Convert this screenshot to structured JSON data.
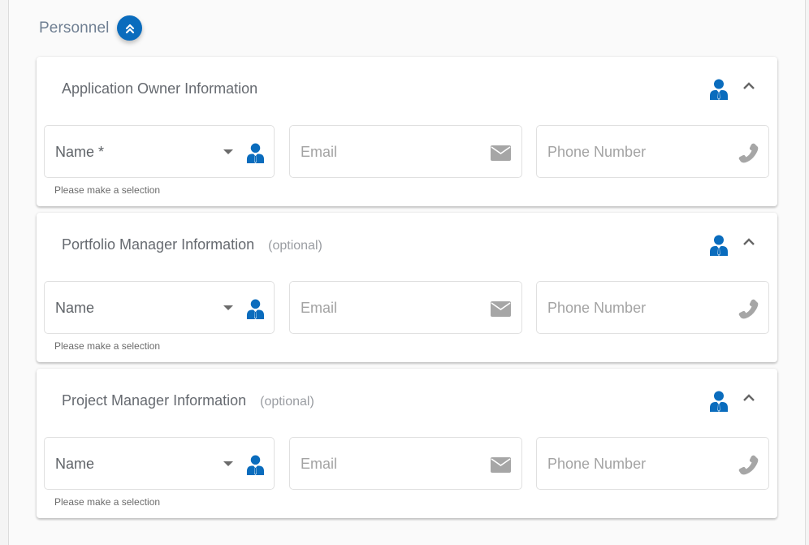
{
  "section": {
    "title": "Personnel",
    "collapse_icon": "double-chevron-up-icon"
  },
  "colors": {
    "accent": "#0a6cbd",
    "icon_gray": "#a6a6a6"
  },
  "cards": [
    {
      "title": "Application Owner Information",
      "optional": "",
      "header_icon": "person-tie-icon",
      "toggle_icon": "chevron-up-icon",
      "name_field": {
        "label": "Name *",
        "helper": "Please make a selection",
        "value": ""
      },
      "email_field": {
        "placeholder": "Email",
        "value": ""
      },
      "phone_field": {
        "placeholder": "Phone Number",
        "value": ""
      }
    },
    {
      "title": "Portfolio Manager Information",
      "optional": "(optional)",
      "header_icon": "person-tie-icon",
      "toggle_icon": "chevron-up-icon",
      "name_field": {
        "label": "Name",
        "helper": "Please make a selection",
        "value": ""
      },
      "email_field": {
        "placeholder": "Email",
        "value": ""
      },
      "phone_field": {
        "placeholder": "Phone Number",
        "value": ""
      }
    },
    {
      "title": "Project Manager Information",
      "optional": "(optional)",
      "header_icon": "person-tie-icon",
      "toggle_icon": "chevron-up-icon",
      "name_field": {
        "label": "Name",
        "helper": "Please make a selection",
        "value": ""
      },
      "email_field": {
        "placeholder": "Email",
        "value": ""
      },
      "phone_field": {
        "placeholder": "Phone Number",
        "value": ""
      }
    }
  ]
}
